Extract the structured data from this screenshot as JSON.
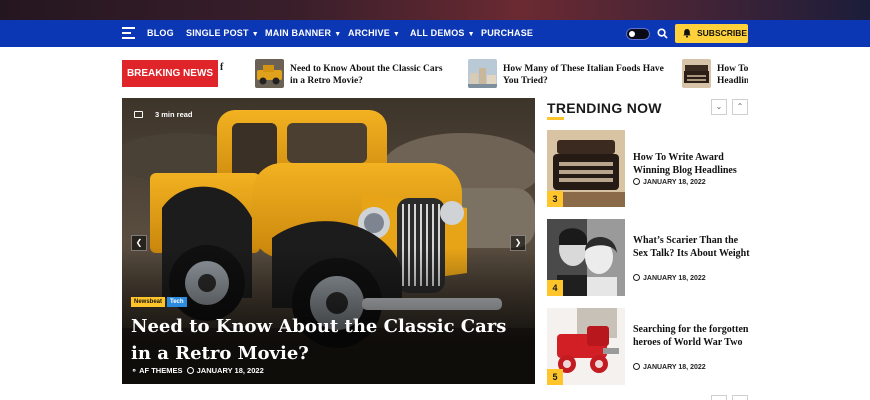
{
  "nav": {
    "items": [
      {
        "label": "BLOG",
        "dropdown": false
      },
      {
        "label": "SINGLE POST",
        "dropdown": true
      },
      {
        "label": "MAIN BANNER",
        "dropdown": true
      },
      {
        "label": "ARCHIVE",
        "dropdown": true
      },
      {
        "label": "ALL DEMOS",
        "dropdown": true
      },
      {
        "label": "PURCHASE",
        "dropdown": false
      }
    ],
    "subscribe_label": "SUBSCRIBE"
  },
  "ticker": {
    "label": "BREAKING NEWS",
    "fragment": "f",
    "items": [
      {
        "title": "Need to Know About the Classic Cars in a Retro Movie?",
        "line1": "Need to Know About the Classic Cars",
        "line2": "in a Retro Movie?"
      },
      {
        "title": "How Many of These Italian Foods Have You Tried?",
        "line1": "How Many of These Italian Foods Have",
        "line2": "You Tried?"
      },
      {
        "title": "How To Write Award Winning Blog Headlines",
        "line1": "How To",
        "line2": "Headlin"
      }
    ]
  },
  "hero": {
    "read_time": "3 min read",
    "categories": [
      "Newsbeat",
      "Tech"
    ],
    "title": "Need to Know About the Classic Cars in a Retro Movie?",
    "author": "AF THEMES",
    "date": "JANUARY 18, 2022"
  },
  "trending": {
    "heading": "TRENDING NOW",
    "items": [
      {
        "rank": "3",
        "title": "How To Write Award Winning Blog Headlines",
        "date": "JANUARY 18, 2022"
      },
      {
        "rank": "4",
        "title": "What’s Scarier Than the Sex Talk? Its About Weight",
        "date": "JANUARY 18, 2022"
      },
      {
        "rank": "5",
        "title": "Searching for the forgotten heroes of World War Two",
        "date": "JANUARY 18, 2022"
      }
    ]
  },
  "colors": {
    "nav_bg": "#0c37b4",
    "breaking_bg": "#e0252a",
    "accent_yellow": "#ffc52b",
    "subscribe_bg": "#ffd23b"
  }
}
